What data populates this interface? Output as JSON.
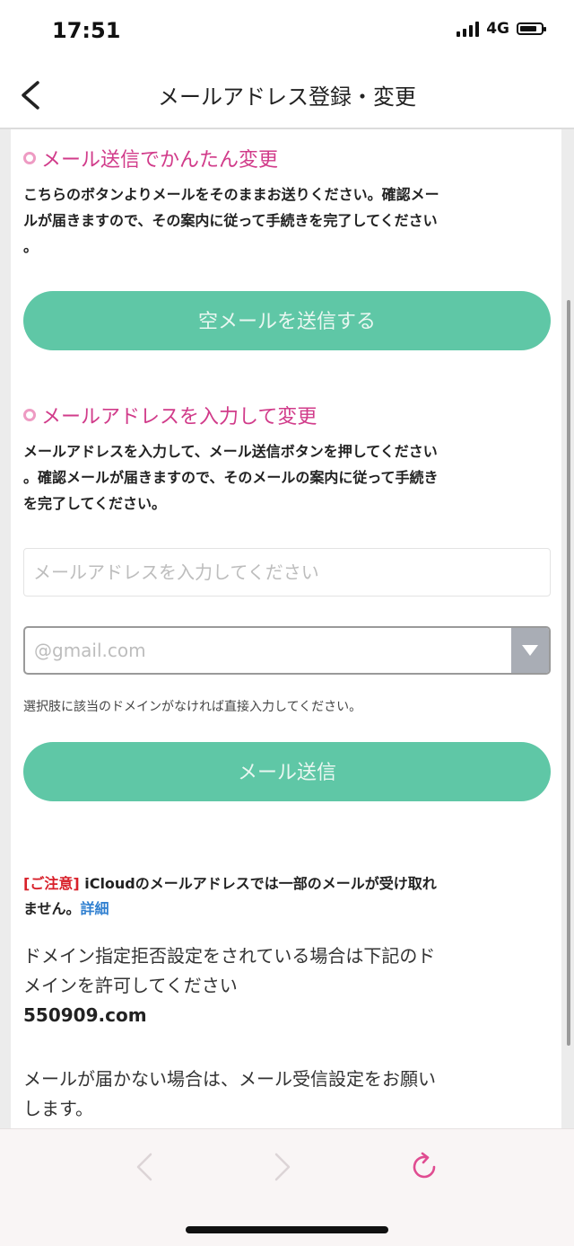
{
  "status_bar": {
    "time": "17:51",
    "network": "4G"
  },
  "nav": {
    "title": "メールアドレス登録・変更"
  },
  "section1": {
    "heading": "メール送信でかんたん変更",
    "desc_lines": [
      "こちらのボタンよりメールをそのままお送りください。確認メー",
      "ルが届きますので、その案内に従って手続きを完了してください",
      "。"
    ],
    "button_label": "空メールを送信する"
  },
  "section2": {
    "heading": "メールアドレスを入力して変更",
    "desc_lines": [
      "メールアドレスを入力して、メール送信ボタンを押してください",
      "。確認メールが届きますので、そのメールの案内に従って手続き",
      "を完了してください。"
    ],
    "email_placeholder": "メールアドレスを入力してください",
    "domain_value": "@gmail.com",
    "hint": "選択肢に該当のドメインがなければ直接入力してください。",
    "button_label": "メール送信"
  },
  "notice": {
    "tag": "[ご注意]",
    "text_line1": " iCloudのメールアドレスでは一部のメールが受け取れ",
    "text_line2": "ません。",
    "link": "詳細"
  },
  "domain_info": {
    "line1": "ドメイン指定拒否設定をされている場合は下記のド",
    "line2": "メインを許可してください",
    "domain": "550909.com"
  },
  "settings_info": {
    "line1": "メールが届かない場合は、メール受信設定をお願い",
    "line2": "します。"
  },
  "colors": {
    "accent_green": "#5fc7a6",
    "heading_pink": "#d13b8a",
    "notice_red": "#d8202a",
    "link_blue": "#2f7fd0"
  }
}
